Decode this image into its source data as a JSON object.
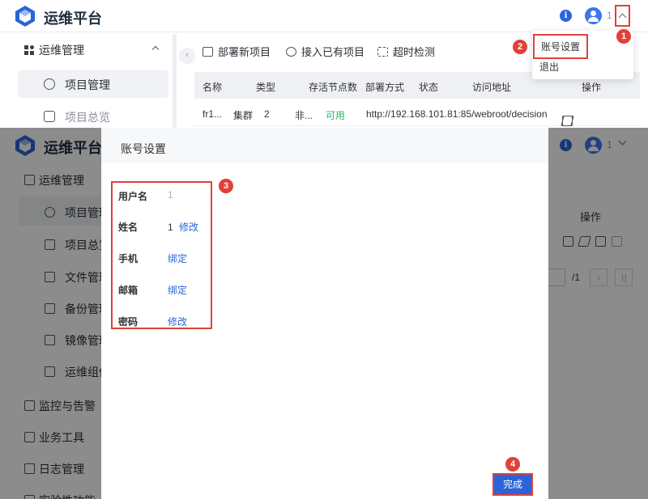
{
  "app": {
    "title": "运维平台"
  },
  "header": {
    "user_name": "1"
  },
  "user_menu": {
    "items": [
      "账号设置",
      "退出"
    ]
  },
  "sidebar": {
    "section_ops": "运维管理",
    "items_top": [
      "项目管理",
      "项目总览"
    ],
    "items_bottom": [
      "项目管理",
      "项目总览",
      "文件管理",
      "备份管理",
      "镜像管理",
      "运维组件"
    ],
    "sections_more": [
      "监控与告警",
      "业务工具",
      "日志管理",
      "实验性功能"
    ]
  },
  "toolbar": {
    "deploy": "部署新项目",
    "join": "接入已有项目",
    "timeout": "超时检测"
  },
  "table": {
    "headers": [
      "名称",
      "类型",
      "存活节点数",
      "部署方式",
      "状态",
      "访问地址",
      "操作"
    ],
    "row": {
      "name": "fr1...",
      "type": "集群",
      "alive": "2",
      "deploy": "非...",
      "status": "可用",
      "url": "http://192.168.101.81:85/webroot/decision"
    }
  },
  "pagination": {
    "total": "/1",
    "prev": "›",
    "last": "⟩|"
  },
  "modal": {
    "title": "账号设置",
    "fields": [
      {
        "label": "用户名",
        "value": "1",
        "action": ""
      },
      {
        "label": "姓名",
        "value": "1",
        "action": "修改"
      },
      {
        "label": "手机",
        "value": "",
        "action": "绑定"
      },
      {
        "label": "邮箱",
        "value": "",
        "action": "绑定"
      },
      {
        "label": "密码",
        "value": "",
        "action": "修改"
      }
    ],
    "done_label": "完成"
  },
  "annotations": [
    "1",
    "2",
    "3",
    "4"
  ],
  "colors": {
    "accent": "#2a64d8",
    "highlight": "#e0413a",
    "success": "#2fb36a"
  }
}
